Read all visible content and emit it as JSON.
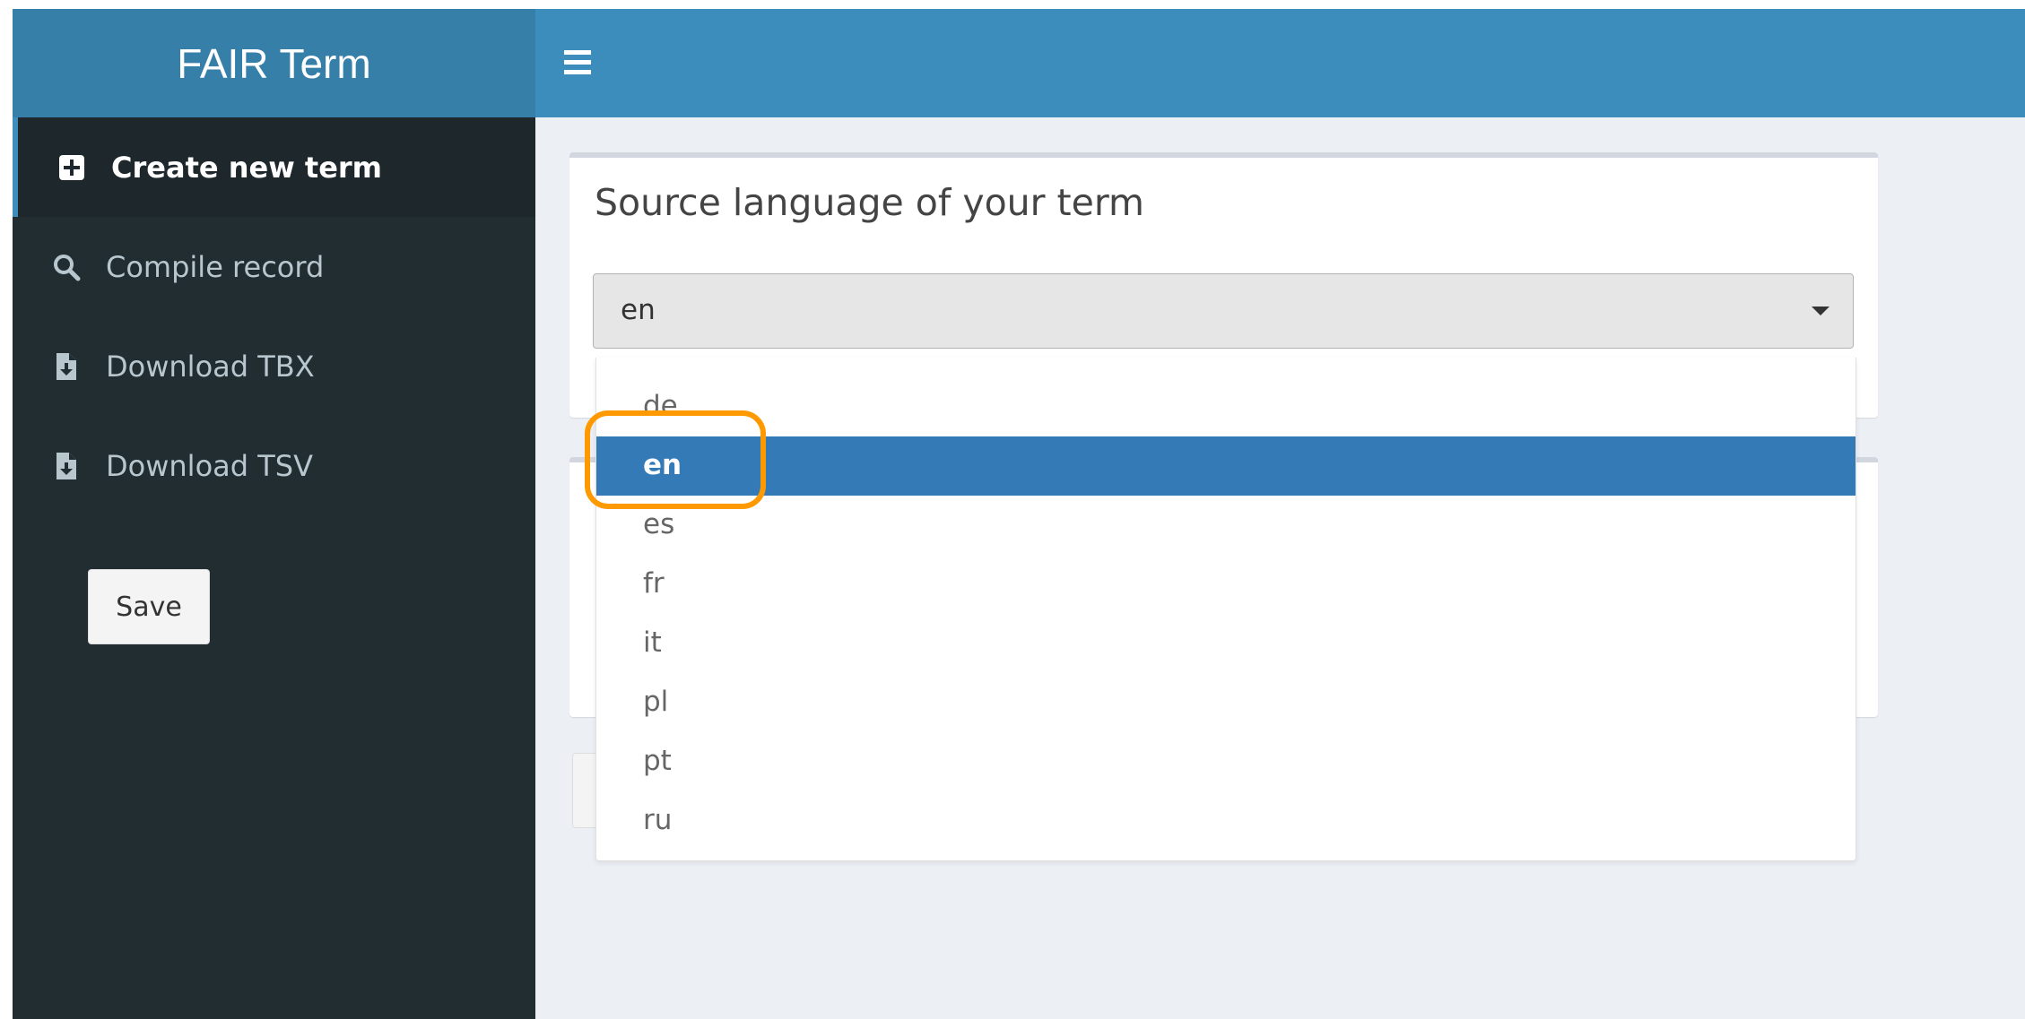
{
  "app": {
    "title": "FAIR Term"
  },
  "header": {
    "menu_toggle_icon": "hamburger-icon",
    "navbar_color": "#3c8dbc",
    "logo_color": "#367fa9"
  },
  "sidebar": {
    "items": [
      {
        "label": "Create new term",
        "icon": "plus-square-icon",
        "active": true
      },
      {
        "label": "Compile record",
        "icon": "search-icon",
        "active": false
      },
      {
        "label": "Download TBX",
        "icon": "file-download-icon",
        "active": false
      },
      {
        "label": "Download TSV",
        "icon": "file-download-icon",
        "active": false
      }
    ],
    "save_label": "Save"
  },
  "main": {
    "source_box": {
      "title": "Source language of your term",
      "select": {
        "value": "en",
        "options": [
          "de",
          "en",
          "es",
          "fr",
          "it",
          "pl",
          "pt",
          "ru"
        ],
        "highlighted": "en"
      }
    }
  },
  "colors": {
    "selected_option": "#337ab7",
    "annotation_ring": "#ff9900",
    "sidebar_bg": "#222d32",
    "content_bg": "#ecf0f5"
  }
}
